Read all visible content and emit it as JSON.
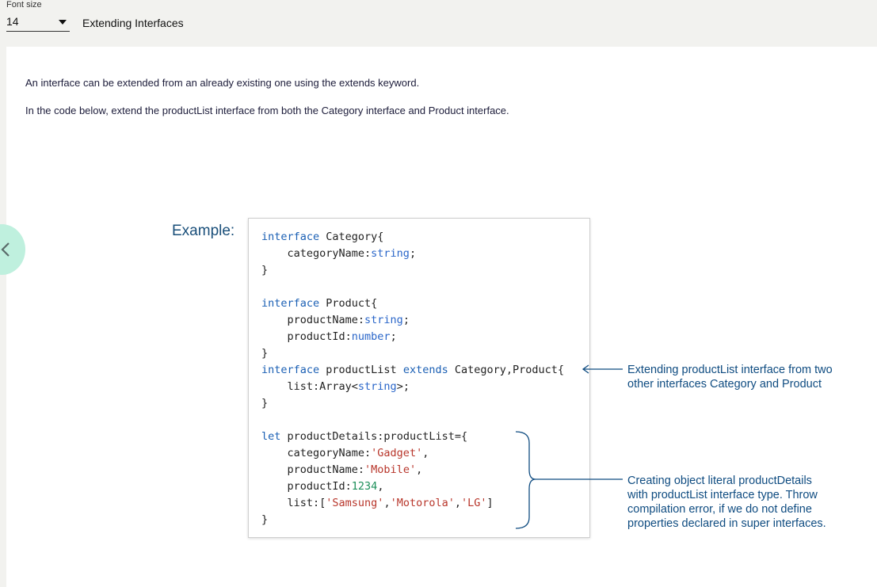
{
  "toolbar": {
    "font_size_label": "Font size",
    "font_size_value": "14",
    "title": "Extending Interfaces"
  },
  "content": {
    "paragraph_1": "An interface can be extended from an already existing one using the extends keyword.",
    "paragraph_2": "In the code below, extend the productList interface from both the Category interface and Product interface.",
    "example_label": "Example:"
  },
  "code_lines": [
    "interface Category{",
    "    categoryName:string;",
    "}",
    "",
    "interface Product{",
    "    productName:string;",
    "    productId:number;",
    "}",
    "interface productList extends Category,Product{",
    "    list:Array<string>;",
    "}",
    "",
    "let productDetails:productList={",
    "    categoryName:'Gadget',",
    "    productName:'Mobile',",
    "    productId:1234,",
    "    list:['Samsung','Motorola','LG']",
    "}"
  ],
  "annotations": {
    "extends_note_line1": "Extending productList interface from two",
    "extends_note_line2": "other interfaces Category and Product",
    "literal_note_line1": "Creating object literal productDetails",
    "literal_note_line2": "with productList interface type. Throw",
    "literal_note_line3": "compilation error, if we do not define",
    "literal_note_line4": "properties declared in super interfaces."
  },
  "colors": {
    "keyword": "#1a5fb4",
    "string": "#b8362b",
    "number": "#1d8f5a",
    "annotation": "#0f4c81",
    "nav_button": "#bff0de"
  },
  "icons": {
    "nav_prev": "chevron-left-icon",
    "dropdown": "caret-down-icon"
  }
}
